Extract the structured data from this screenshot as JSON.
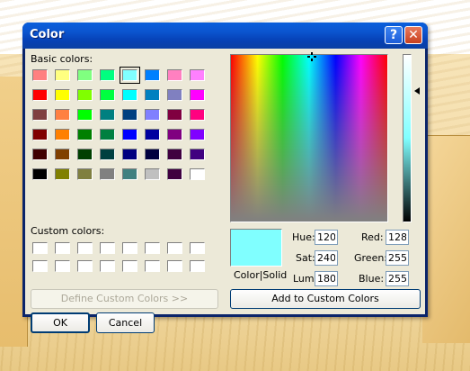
{
  "window": {
    "title": "Color"
  },
  "titlebar": {
    "help_glyph": "?",
    "close_glyph": "✕"
  },
  "labels": {
    "basic_colors": "Basic colors:",
    "custom_colors": "Custom colors:",
    "color_solid": "Color|Solid"
  },
  "buttons": {
    "define_custom": "Define Custom Colors >>",
    "ok": "OK",
    "cancel": "Cancel",
    "add_custom": "Add to Custom Colors"
  },
  "basic_colors": [
    [
      "#ff8080",
      "#ffff80",
      "#80ff80",
      "#00ff80",
      "#80ffff",
      "#0080ff",
      "#ff80c0",
      "#ff80ff"
    ],
    [
      "#ff0000",
      "#ffff00",
      "#80ff00",
      "#00ff40",
      "#00ffff",
      "#0080c0",
      "#8080c0",
      "#ff00ff"
    ],
    [
      "#804040",
      "#ff8040",
      "#00ff00",
      "#008080",
      "#004080",
      "#8080ff",
      "#800040",
      "#ff0080"
    ],
    [
      "#800000",
      "#ff8000",
      "#008000",
      "#008040",
      "#0000ff",
      "#0000a0",
      "#800080",
      "#8000ff"
    ],
    [
      "#400000",
      "#804000",
      "#004000",
      "#004040",
      "#000080",
      "#000040",
      "#400040",
      "#400080"
    ],
    [
      "#000000",
      "#808000",
      "#808040",
      "#808080",
      "#408080",
      "#c0c0c0",
      "#400040",
      "#ffffff"
    ]
  ],
  "selected_basic": {
    "row": 0,
    "col": 4
  },
  "current_color": "#80ffff",
  "fields": {
    "hue": {
      "label": "Hue:",
      "value": "120"
    },
    "sat": {
      "label": "Sat:",
      "value": "240"
    },
    "lum": {
      "label": "Lum:",
      "value": "180"
    },
    "red": {
      "label": "Red:",
      "value": "128"
    },
    "green": {
      "label": "Green:",
      "value": "255"
    },
    "blue": {
      "label": "Blue:",
      "value": "255"
    }
  }
}
